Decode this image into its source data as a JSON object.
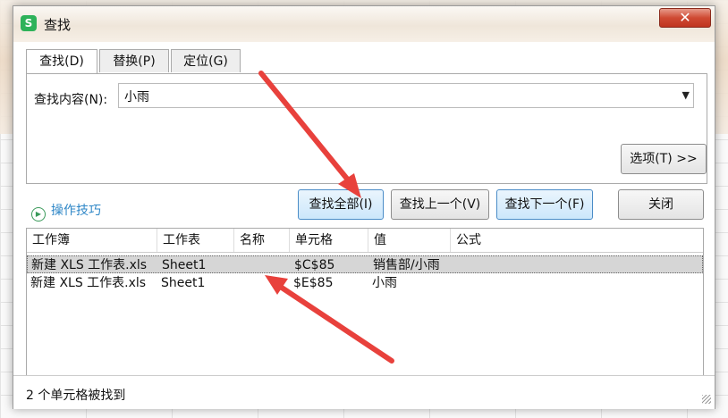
{
  "window": {
    "title": "查找",
    "close_glyph": "✕",
    "app_icon_letter": "S"
  },
  "tabs": [
    {
      "label": "查找(D)",
      "active": true
    },
    {
      "label": "替换(P)",
      "active": false
    },
    {
      "label": "定位(G)",
      "active": false
    }
  ],
  "find": {
    "label": "查找内容(N):",
    "value": "小雨"
  },
  "buttons": {
    "options": "选项(T) >>",
    "find_all": "查找全部(I)",
    "find_prev": "查找上一个(V)",
    "find_next": "查找下一个(F)",
    "close": "关闭"
  },
  "tips": {
    "label": "操作技巧"
  },
  "results": {
    "columns": [
      "工作簿",
      "工作表",
      "名称",
      "单元格",
      "值",
      "公式"
    ],
    "rows": [
      {
        "workbook": "新建 XLS 工作表.xls",
        "sheet": "Sheet1",
        "name": "",
        "cell": "$C$85",
        "value": "销售部/小雨",
        "formula": "",
        "selected": true
      },
      {
        "workbook": "新建 XLS 工作表.xls",
        "sheet": "Sheet1",
        "name": "",
        "cell": "$E$85",
        "value": "小雨",
        "formula": "",
        "selected": false
      }
    ]
  },
  "status": {
    "text": "2 个单元格被找到"
  },
  "colors": {
    "arrow": "#e8413c",
    "link": "#2f87c7",
    "selection": "#d6d6d6"
  }
}
